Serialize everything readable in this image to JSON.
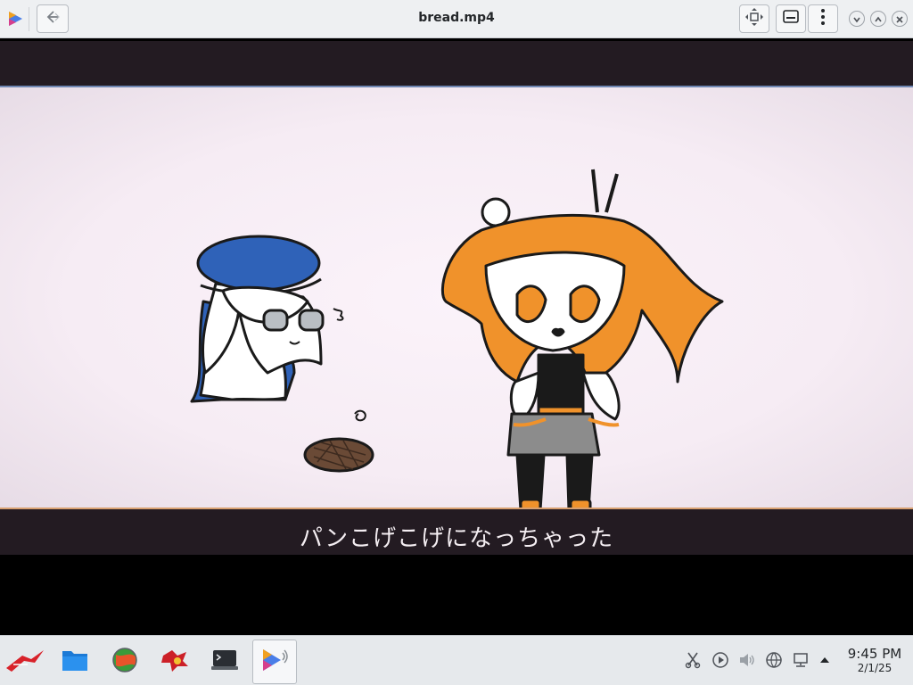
{
  "window": {
    "title": "bread.mp4"
  },
  "video": {
    "subtitle": "パンこげこげになっちゃった"
  },
  "icons": {
    "app": "media-player-icon",
    "back": "back-arrow-icon",
    "move": "move-arrows-icon",
    "subtitles": "subtitles-icon",
    "menu": "kebab-menu-icon",
    "minimize": "chevron-down-icon",
    "maximize": "chevron-up-icon",
    "close": "close-icon"
  },
  "taskbar": {
    "apps": [
      "app-launcher",
      "file-manager",
      "web-browser",
      "game",
      "terminal",
      "media-player"
    ],
    "tray": [
      "clipboard-icon",
      "media-play-icon",
      "volume-icon",
      "network-globe-icon",
      "display-icon",
      "expand-tray-icon"
    ]
  },
  "clock": {
    "time": "9:45 PM",
    "date": "2/1/25"
  },
  "colors": {
    "titlebar": "#eef0f2",
    "letterbox": "#000000",
    "band": "#231b22",
    "frame": "#f8eef6",
    "taskbar": "#e6e9ec"
  }
}
